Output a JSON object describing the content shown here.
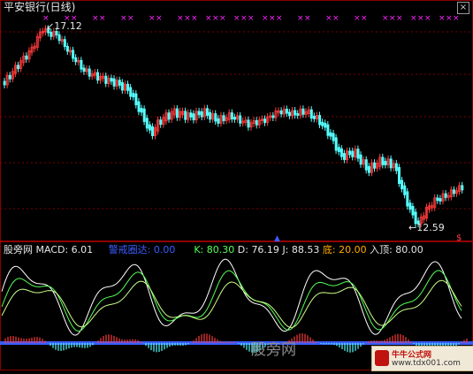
{
  "window": {
    "title": "平安银行(日线)",
    "close_label": "×"
  },
  "price_chart": {
    "high_label": "17.12",
    "low_label": "12.59",
    "up_color": "#ff3b3b",
    "down_color": "#55ffff",
    "mark_color": "#ff22ff"
  },
  "indicators": {
    "name": "股旁网",
    "macd": {
      "label": "MACD: 6.01",
      "color": "#e6e6e6"
    },
    "warn": {
      "label": "警戒圈达: 0.00",
      "color": "#3a5cff"
    },
    "k": {
      "label": "K: 80.30",
      "color": "#e6e6e6"
    },
    "d": {
      "label": "D: 76.19",
      "color": "#ffff55"
    },
    "j": {
      "label": "J: 88.53",
      "color": "#ff55ff"
    },
    "bottom": {
      "label": "底: 20.00",
      "color": "#e6e6e6"
    },
    "top": {
      "label": "入顶: 80.00",
      "color": "#e6e6e6"
    }
  },
  "watermark": {
    "site_name": "股旁网",
    "logo_line1": "牛牛公式网",
    "logo_line2": "www.tdx001.com"
  }
}
